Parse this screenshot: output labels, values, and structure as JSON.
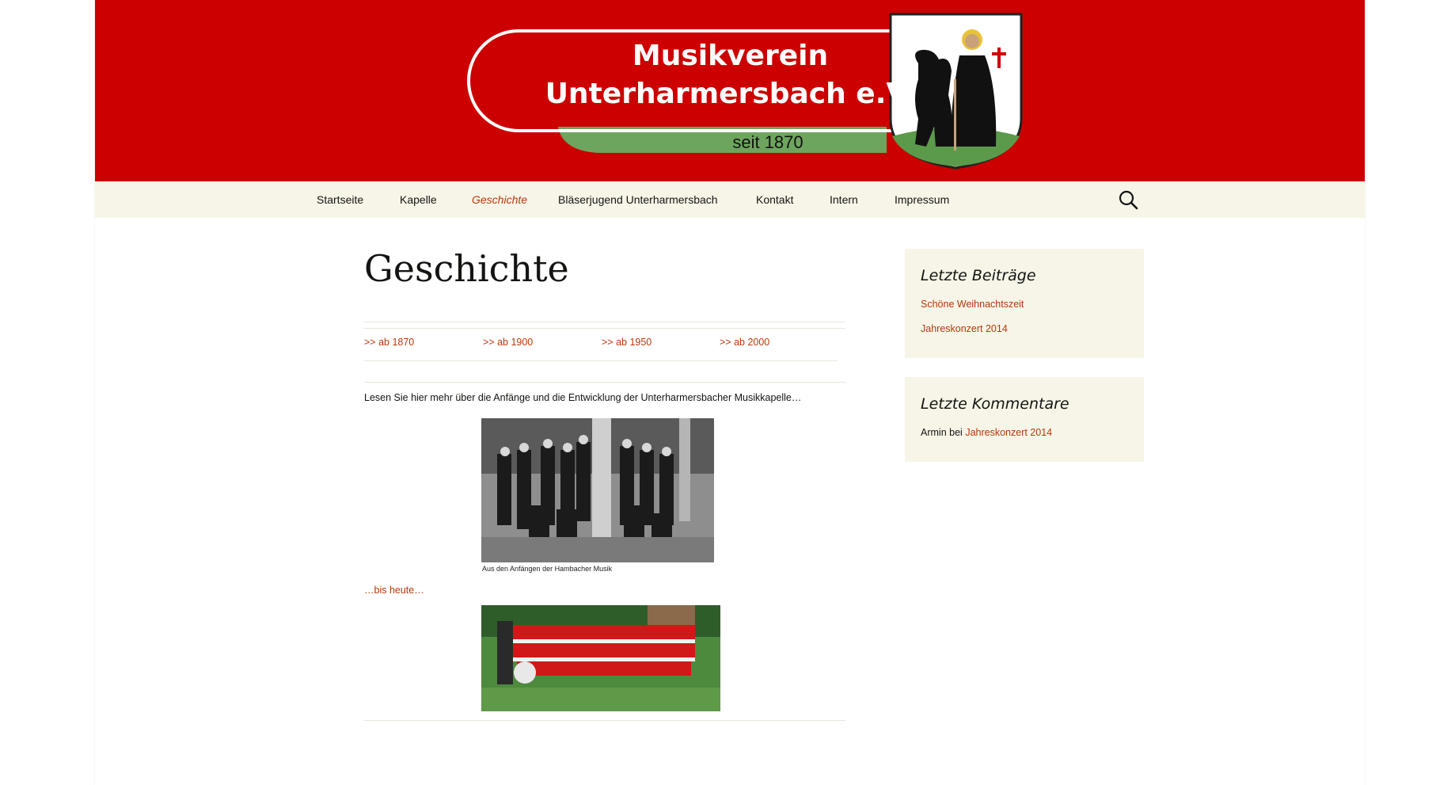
{
  "header": {
    "title_line1": "Musikverein",
    "title_line2": "Unterharmersbach e.V.",
    "since": "seit 1870",
    "colors": {
      "banner_red": "#cc0000",
      "ribbon_green": "#6ea55e",
      "nav_bg": "#f7f5e7",
      "link": "#bc360a"
    },
    "crest_icon": "coat-of-arms-bear-monk"
  },
  "nav": {
    "items": [
      {
        "label": "Startseite"
      },
      {
        "label": "Kapelle"
      },
      {
        "label": "Geschichte",
        "current": true
      },
      {
        "label": "Bläserjugend Unterharmersbach"
      },
      {
        "label": "Kontakt"
      },
      {
        "label": "Intern"
      },
      {
        "label": "Impressum"
      }
    ],
    "search_icon": "search-icon"
  },
  "main": {
    "title": "Geschichte",
    "era_links": [
      {
        "label": ">> ab 1870"
      },
      {
        "label": ">> ab 1900"
      },
      {
        "label": ">> ab 1950"
      },
      {
        "label": ">> ab 2000"
      }
    ],
    "intro": "Lesen Sie hier mehr über die Anfänge und die Entwicklung der Unterharmersbacher Musikkapelle…",
    "photo_old_caption": "Aus den Anfängen der Hambacher Musik",
    "bis_heute": "…bis heute…"
  },
  "sidebar": {
    "recent_posts": {
      "title": "Letzte Beiträge",
      "items": [
        {
          "label": "Schöne Weihnachtszeit"
        },
        {
          "label": "Jahreskonzert 2014"
        }
      ]
    },
    "recent_comments": {
      "title": "Letzte Kommentare",
      "author": "Armin",
      "connector": "bei",
      "post": "Jahreskonzert 2014"
    }
  }
}
